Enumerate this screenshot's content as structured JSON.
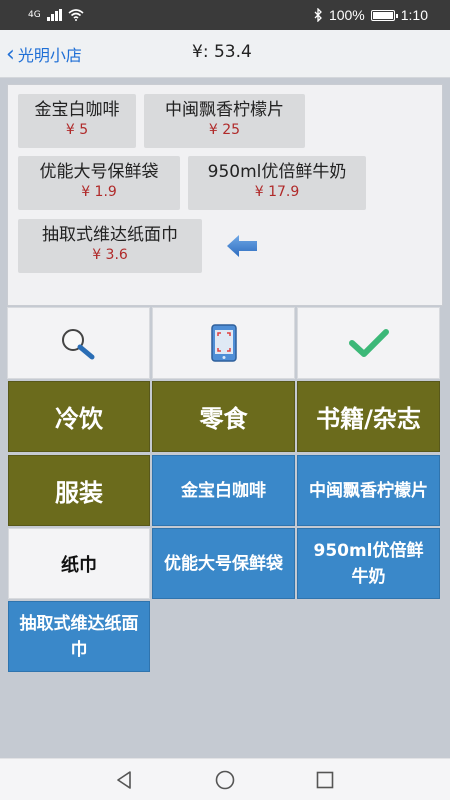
{
  "status": {
    "network": "4G",
    "battery": "100%",
    "time": "1:10",
    "bluetooth_icon": "bluetooth-icon"
  },
  "header": {
    "back_label": "光明小店",
    "total": "¥: 53.4"
  },
  "order_items": [
    {
      "name": "金宝白咖啡",
      "price": "¥ 5"
    },
    {
      "name": "中闽飘香柠檬片",
      "price": "¥ 25"
    },
    {
      "name": "优能大号保鲜袋",
      "price": "¥ 1.9"
    },
    {
      "name": "950ml优倍鲜牛奶",
      "price": "¥ 17.9"
    },
    {
      "name": "抽取式维达纸面巾",
      "price": "¥ 3.6"
    }
  ],
  "tools": {
    "search_icon": "magnifier-icon",
    "scan_icon": "scan-phone-icon",
    "confirm_icon": "checkmark-icon"
  },
  "categories": [
    "冷饮",
    "零食",
    "书籍/杂志",
    "服装",
    "纸巾"
  ],
  "products": [
    "金宝白咖啡",
    "中闽飘香柠檬片",
    "优能大号保鲜袋",
    "950ml优倍鲜牛奶",
    "抽取式维达纸面巾"
  ],
  "colors": {
    "category_bg": "#6b6b1c",
    "product_bg": "#3a88c9",
    "price": "#b02a2a",
    "link": "#1f6fd6",
    "check": "#3cb878"
  }
}
